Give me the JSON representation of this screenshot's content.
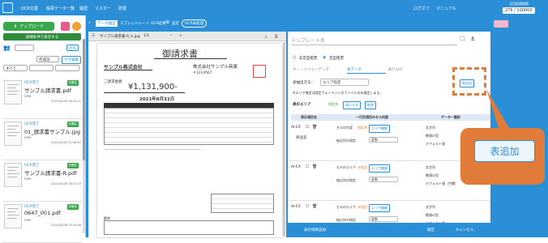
{
  "topbar": {
    "menu": [
      "OCR文書",
      "帳票データ一覧",
      "履歴",
      "マスター",
      "辞書"
    ],
    "logout": "ログオフ",
    "manual": "マニュアル",
    "counter_label": "当月処理枚数",
    "counter_value": "276 / 100000"
  },
  "sidebar": {
    "upload_label": "アップロード",
    "detail_search_label": "詳細条件で表示する",
    "owner_button": "社内",
    "sort_select": "作成日",
    "tag_button": "タグ編集",
    "filter_all": "すべて",
    "docs": [
      {
        "ocr": "OCR完了",
        "status": "未確定",
        "name": "サンプル請求書.pdf",
        "meta1": "DPW",
        "meta2": "2021/04/30 16:14:11"
      },
      {
        "ocr": "OCR完了",
        "status": "未確定",
        "name": "01_請求書サンプル.jpg",
        "meta1": "DPW",
        "meta2": "2021/04/29 22:48:47"
      },
      {
        "ocr": "OCR完了",
        "status": "未確定",
        "name": "サンプル請求書-R.pdf",
        "meta1": "DPW",
        "meta2": "2021/04/29 16:14:19"
      },
      {
        "ocr": "OCR完了",
        "status": "未確定",
        "name": "0647_001.pdf",
        "meta1": "DPW",
        "meta2": "2021/04/28 15:15:48"
      }
    ]
  },
  "tabs": {
    "items": [
      "データ抽出",
      "スプレッドシート",
      "OCR結果"
    ],
    "setting": "設定",
    "rerun": "OCR再処理"
  },
  "viewer": {
    "filename": "サンプル請求書-R_h.jpg",
    "page": "1/1",
    "doc_title": "御請求書",
    "buyer": "サンプル株式会社",
    "seller": "株式会社サンプル商事",
    "amount_label": "ご請求金額",
    "amount": "¥1,131,900-",
    "date": "2021年8月31日",
    "seller_addr": "〒123-4567",
    "notes_label": "備考"
  },
  "editor": {
    "template_placeholder": "テンプレート名",
    "radio_unregistered": "非定型帳票",
    "radio_fixed": "定型帳票",
    "subtabs": [
      "キー・バリューデータ",
      "表データ",
      "振り分け"
    ],
    "table_range_label": "表抽出方法：",
    "table_range_value": "エリア指定",
    "add_table_btn": "表追加",
    "hint": "※エリア指定は固定フォーマットのファイルのみ指定します。",
    "table_area": "表のエリア",
    "designated": "指定済",
    "show_btn": "表示する",
    "delete_btn": "削除",
    "col_headers": [
      "表示項目名",
      "一行目項目のセル内容",
      "データー整形"
    ],
    "rows": [
      {
        "tag": "AI-EX",
        "field": "商品名",
        "cell1": "セルの内容",
        "cell1_tag": "指定済",
        "area": "エリア編集",
        "cell2": "抽出列の指定",
        "cell2_val": "変数",
        "type": "文字列",
        "sub": "数値の型",
        "default": "デフォルト値"
      },
      {
        "tag": "AI-EX",
        "field": "",
        "cell1": "セルのエリア",
        "cell1_tag": "未指定",
        "area": "エリア編集",
        "cell2": "抽出列の指定",
        "cell2_val": "変数",
        "type": "文字列",
        "sub": "数値の型",
        "default": "デフォルト値（空欄）"
      },
      {
        "tag": "AI-EX",
        "field": "",
        "cell1": "セルのエリア",
        "cell1_tag": "未指定",
        "area": "エリア編集",
        "cell2": "抽出列の指定",
        "cell2_val": "変数",
        "type": "文字列",
        "sub": "数値の型",
        "default": "デフォルト値"
      }
    ],
    "footer_show": "表示項目追加",
    "footer_confirm": "確定",
    "footer_cancel": "キャンセル"
  },
  "callout": {
    "label": "表追加"
  }
}
